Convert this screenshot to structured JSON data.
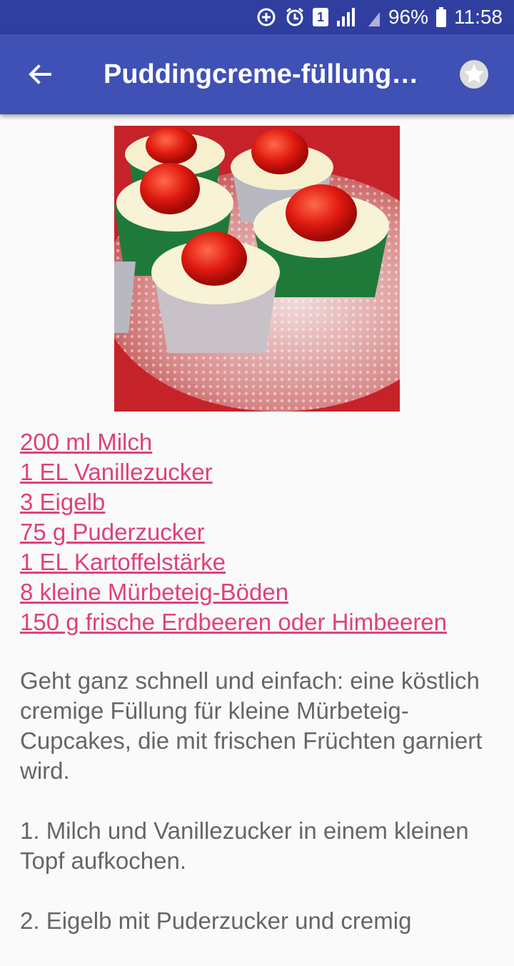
{
  "status_bar": {
    "battery": "96%",
    "time": "11:58",
    "sim_badge": "1",
    "icons": [
      "data-saver-icon",
      "alarm-icon",
      "sim-icon",
      "signal-icon",
      "signal-icon",
      "battery-icon"
    ]
  },
  "appbar": {
    "title": "Puddingcreme-füllung…",
    "back_icon": "arrow-left-icon",
    "favorite_icon": "star-icon"
  },
  "colors": {
    "status": "#303F9F",
    "primary": "#3F51B5",
    "link": "#E0407B",
    "text": "#666666"
  },
  "ingredients": [
    "200 ml Milch",
    "1 EL Vanillezucker",
    "3 Eigelb",
    "75 g Puderzucker",
    "1 EL Kartoffelstärke",
    "8 kleine Mürbeteig-Böden",
    "150 g frische Erdbeeren oder Himbeeren"
  ],
  "description": [
    "Geht ganz schnell und einfach: eine köstlich cremige Füllung für kleine Mürbeteig-Cupcakes, die mit frischen Früchten garniert wird.",
    "1. Milch und Vanillezucker in einem kleinen Topf aufkochen.",
    "2. Eigelb mit Puderzucker und cremig"
  ]
}
